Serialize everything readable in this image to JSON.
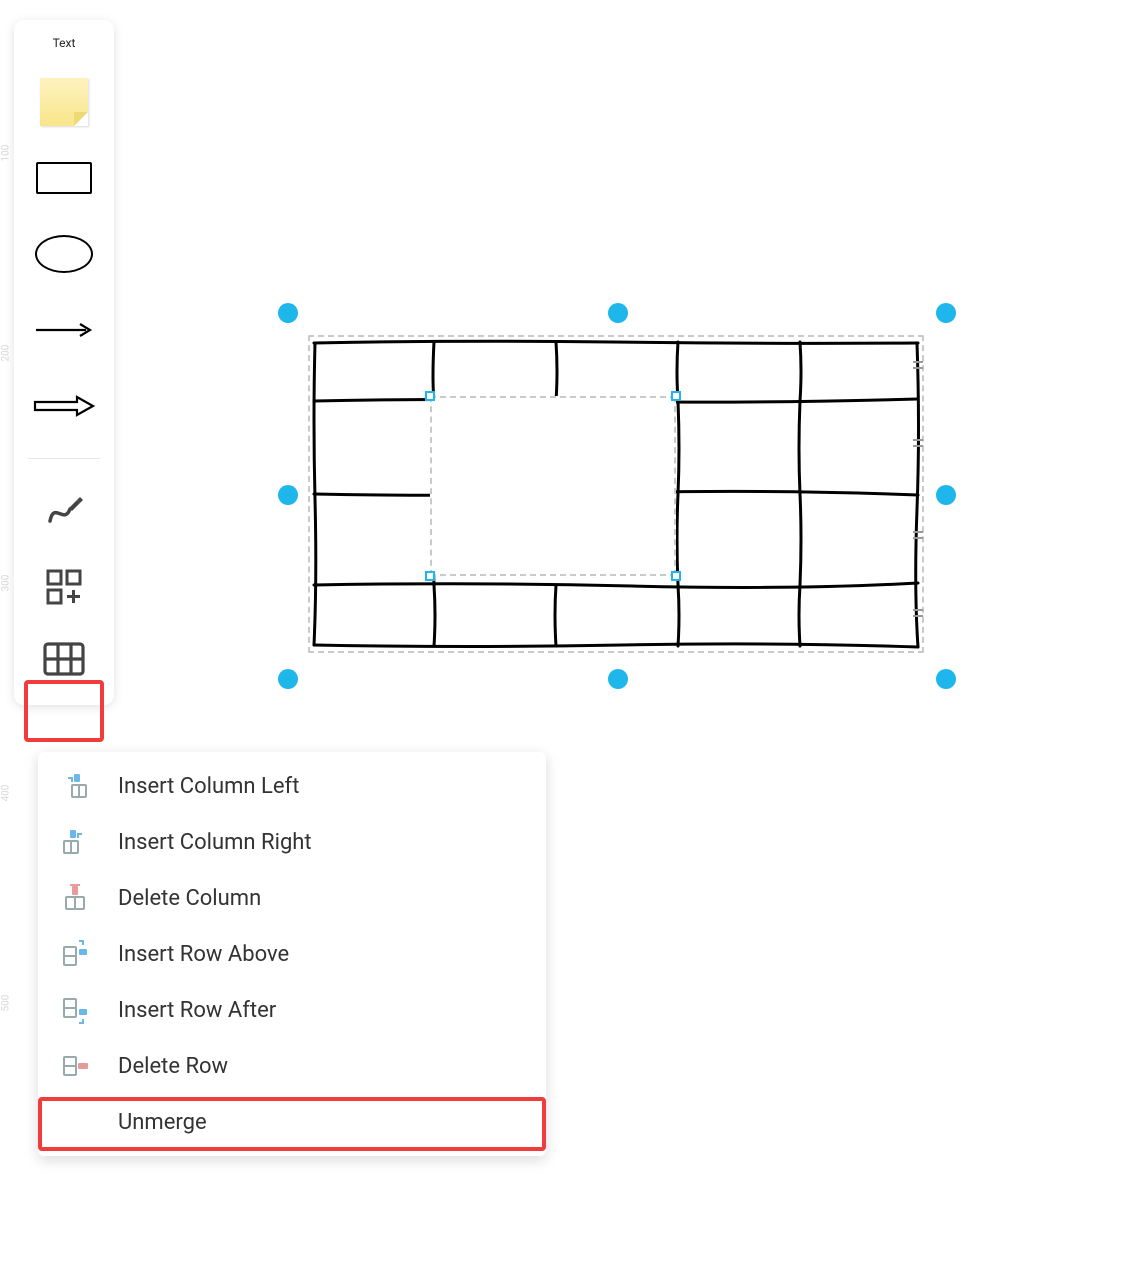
{
  "ruler": {
    "marks": [
      "100",
      "200",
      "300",
      "400",
      "500"
    ]
  },
  "toolbar": {
    "text_label": "Text"
  },
  "menu": {
    "items": [
      {
        "label": "Insert Column Left"
      },
      {
        "label": "Insert Column Right"
      },
      {
        "label": "Delete Column"
      },
      {
        "label": "Insert Row Above"
      },
      {
        "label": "Insert Row After"
      },
      {
        "label": "Delete Row"
      },
      {
        "label": "Unmerge"
      }
    ]
  },
  "canvas_table": {
    "rows": 4,
    "cols": 5,
    "merged_cell": {
      "row_start": 1,
      "row_end": 2,
      "col_start": 1,
      "col_end": 2
    }
  },
  "highlights": {
    "toolbar_button": "table-tool",
    "menu_item": "Unmerge"
  },
  "colors": {
    "selection_dot": "#1fb6eb",
    "highlight_red": "#f13c3c"
  }
}
